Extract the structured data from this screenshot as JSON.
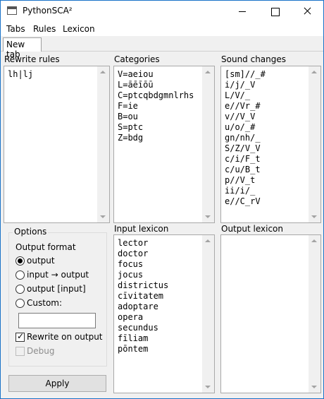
{
  "window": {
    "title": "PythonSCA²"
  },
  "menu": {
    "items": [
      "Tabs",
      "Rules",
      "Lexicon"
    ]
  },
  "tabs": [
    {
      "label": "New tab"
    }
  ],
  "rewrite_rules": {
    "label": "Rewrite rules",
    "text": "lh|lj"
  },
  "categories": {
    "label": "Categories",
    "lines": [
      "V=aeiou",
      "L=āēīōū",
      "C=ptcqbdgmnlrhs",
      "F=ie",
      "B=ou",
      "S=ptc",
      "Z=bdg"
    ]
  },
  "sound_changes": {
    "label": "Sound changes",
    "lines": [
      "[sm]//_#",
      "i/j/_V",
      "L/V/_",
      "e//Vr_#",
      "v//V_V",
      "u/o/_#",
      "gn/nh/_",
      "S/Z/V_V",
      "c/i/F_t",
      "c/u/B_t",
      "p//V_t",
      "ii/i/_",
      "e//C_rV"
    ]
  },
  "input_lexicon": {
    "label": "Input lexicon",
    "lines": [
      "lector",
      "doctor",
      "focus",
      "jocus",
      "districtus",
      "cīvitatem",
      "adoptare",
      "opera",
      "secundus",
      "fīliam",
      "pōntem"
    ]
  },
  "output_lexicon": {
    "label": "Output lexicon",
    "lines": []
  },
  "options": {
    "group_label": "Options",
    "format_label": "Output format",
    "radios": [
      {
        "label": "output",
        "checked": true
      },
      {
        "label": "input → output",
        "checked": false
      },
      {
        "label": "output [input]",
        "checked": false
      },
      {
        "label": "Custom:",
        "checked": false
      }
    ],
    "custom_value": "",
    "rewrite_on_output": {
      "label": "Rewrite on output",
      "checked": true
    },
    "debug": {
      "label": "Debug",
      "checked": false,
      "disabled": true
    }
  },
  "apply_button": {
    "label": "Apply"
  }
}
